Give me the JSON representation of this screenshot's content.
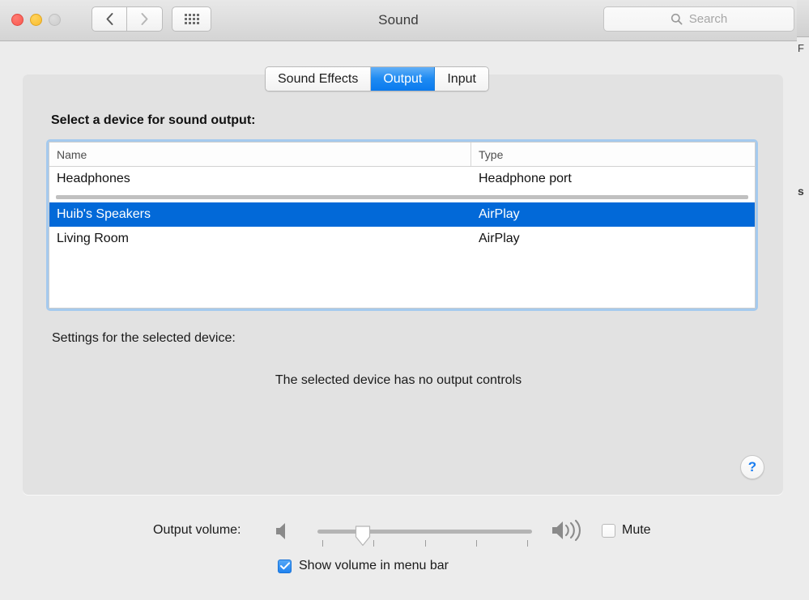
{
  "window": {
    "title": "Sound",
    "traffic_lights": [
      "close",
      "minimize",
      "zoom-disabled"
    ],
    "back_label": "Back",
    "forward_label": "Forward",
    "grid_label": "Show All"
  },
  "search": {
    "value": "",
    "placeholder": "Search",
    "icon": "search-icon"
  },
  "tabs": [
    {
      "label": "Sound Effects",
      "active": false
    },
    {
      "label": "Output",
      "active": true
    },
    {
      "label": "Input",
      "active": false
    }
  ],
  "main": {
    "select_label": "Select a device for sound output:",
    "settings_label": "Settings for the selected device:",
    "no_controls_text": "The selected device has no output controls",
    "help_label": "?"
  },
  "device_table": {
    "columns": [
      "Name",
      "Type"
    ],
    "groups": [
      {
        "rows": [
          {
            "name": "Headphones",
            "type": "Headphone port",
            "selected": false
          }
        ]
      },
      {
        "rows": [
          {
            "name": "Huib's Speakers",
            "type": "AirPlay",
            "selected": true
          },
          {
            "name": "Living Room",
            "type": "AirPlay",
            "selected": false
          }
        ]
      }
    ]
  },
  "volume": {
    "label": "Output volume:",
    "slider_value_percent": 21,
    "tick_count": 5,
    "low_icon": "speaker-mute-icon",
    "high_icon": "speaker-loud-icon",
    "mute": {
      "label": "Mute",
      "checked": false
    },
    "show_in_menu_bar": {
      "label": "Show volume in menu bar",
      "checked": true
    }
  },
  "colors": {
    "selection_blue": "#0269d8",
    "tab_active_blue": "#1f8bf2",
    "focus_ring": "#a5caee",
    "help_blue": "#1a7df0",
    "panel_bg": "#e2e2e2",
    "window_bg": "#ececec"
  },
  "background_window": {
    "fragments": [
      "F",
      "s"
    ]
  }
}
